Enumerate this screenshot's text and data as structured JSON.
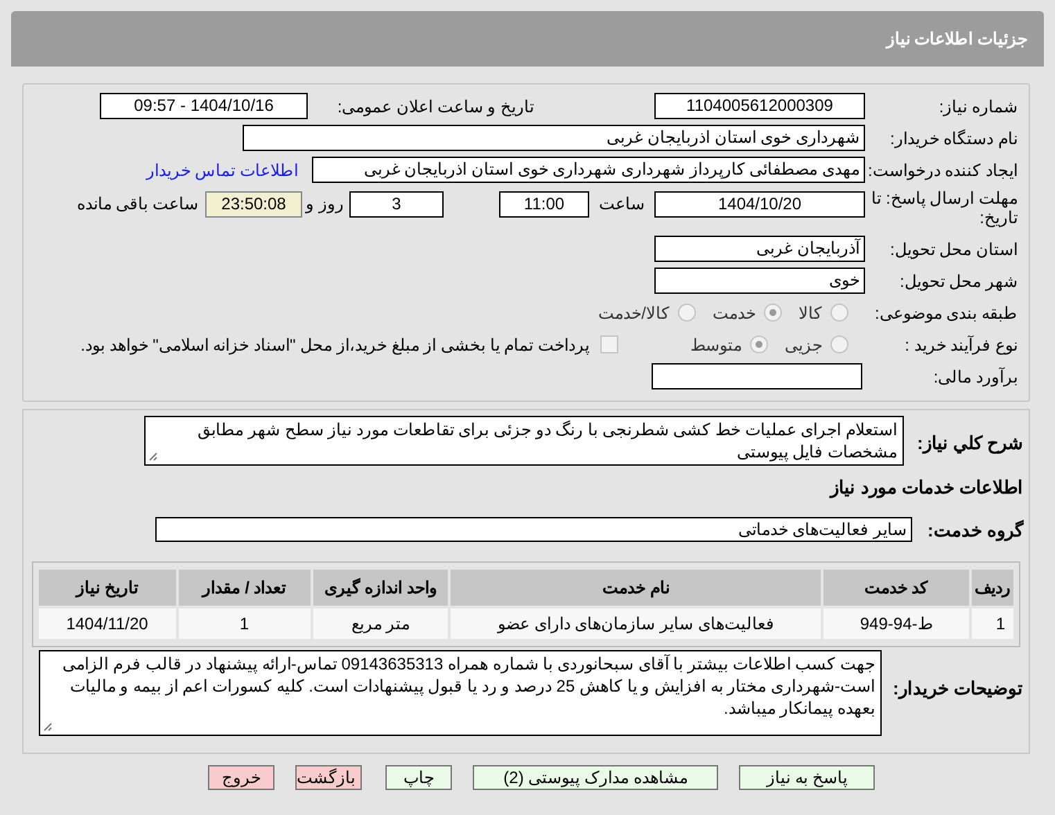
{
  "header": {
    "title": "جزئیات اطلاعات نیاز"
  },
  "details": {
    "need_number": {
      "label": "شماره نیاز:",
      "value": "1104005612000309"
    },
    "announce": {
      "label": "تاریخ و ساعت اعلان عمومی:",
      "value": "1404/10/16 - 09:57"
    },
    "buyer": {
      "label": "نام دستگاه خریدار:",
      "value": "شهرداری خوی استان اذربایجان غربی"
    },
    "creator": {
      "label": "ایجاد کننده درخواست:",
      "value": "مهدی مصطفائی کارپرداز شهرداری شهرداری خوی استان اذربایجان غربی",
      "link": "اطلاعات تماس خریدار"
    },
    "deadline": {
      "label": "مهلت ارسال پاسخ: تا تاریخ:",
      "date": "1404/10/20",
      "time_label": "ساعت",
      "time": "11:00",
      "days": "3",
      "days_label": "روز و",
      "remaining": "23:50:08",
      "remaining_label": "ساعت باقی مانده"
    },
    "province": {
      "label": "استان محل تحویل:",
      "value": "آذربایجان غربی"
    },
    "city": {
      "label": "شهر محل تحویل:",
      "value": "خوی"
    },
    "category": {
      "label": "طبقه بندی موضوعی:",
      "options": [
        {
          "label": "کالا",
          "selected": false
        },
        {
          "label": "خدمت",
          "selected": true
        },
        {
          "label": "کالا/خدمت",
          "selected": false
        }
      ]
    },
    "process": {
      "label": "نوع فرآیند خرید :",
      "options": [
        {
          "label": "جزیی",
          "selected": false
        },
        {
          "label": "متوسط",
          "selected": true
        }
      ],
      "payment": {
        "label": "پرداخت تمام یا بخشی از مبلغ خرید،از محل \"اسناد خزانه اسلامی\" خواهد بود.",
        "checked": false
      }
    },
    "estimate": {
      "label": "برآورد مالی:"
    }
  },
  "description": {
    "label": "شرح کلي نياز:",
    "value": "استعلام اجرای عملیات خط کشی شطرنجی با رنگ دو جزئی برای تقاطعات مورد نیاز سطح شهر مطابق مشخصات فایل پیوستی"
  },
  "services_title": "اطلاعات خدمات مورد نیاز",
  "service_group": {
    "label": "گروه خدمت:",
    "value": "سایر فعالیت‌های خدماتی"
  },
  "table": {
    "columns": [
      "ردیف",
      "کد خدمت",
      "نام خدمت",
      "واحد اندازه گیری",
      "تعداد / مقدار",
      "تاریخ نیاز"
    ],
    "rows": [
      [
        "1",
        "ط-94-949",
        "فعالیت‌های سایر سازمان‌های دارای عضو",
        "متر مربع",
        "1",
        "1404/11/20"
      ]
    ]
  },
  "buyer_notes": {
    "label": "توضیحات خریدار:",
    "value": "جهت کسب اطلاعات بیشتر با آقای سبحانوردی با شماره همراه 09143635313 تماس-ارائه پیشنهاد در قالب فرم الزامی است-شهرداری مختار به افزایش و یا کاهش 25 درصد و رد یا قبول پیشنهادات است. کلیه کسورات اعم از بیمه و مالیات بعهده پیمانکار میباشد."
  },
  "buttons": [
    {
      "label": "پاسخ به نیاز",
      "kind": "normal"
    },
    {
      "label": "مشاهده مدارک پیوستی (2)",
      "kind": "normal"
    },
    {
      "label": "چاپ",
      "kind": "normal"
    },
    {
      "label": "بازگشت",
      "kind": "danger"
    },
    {
      "label": "خروج",
      "kind": "danger"
    }
  ]
}
